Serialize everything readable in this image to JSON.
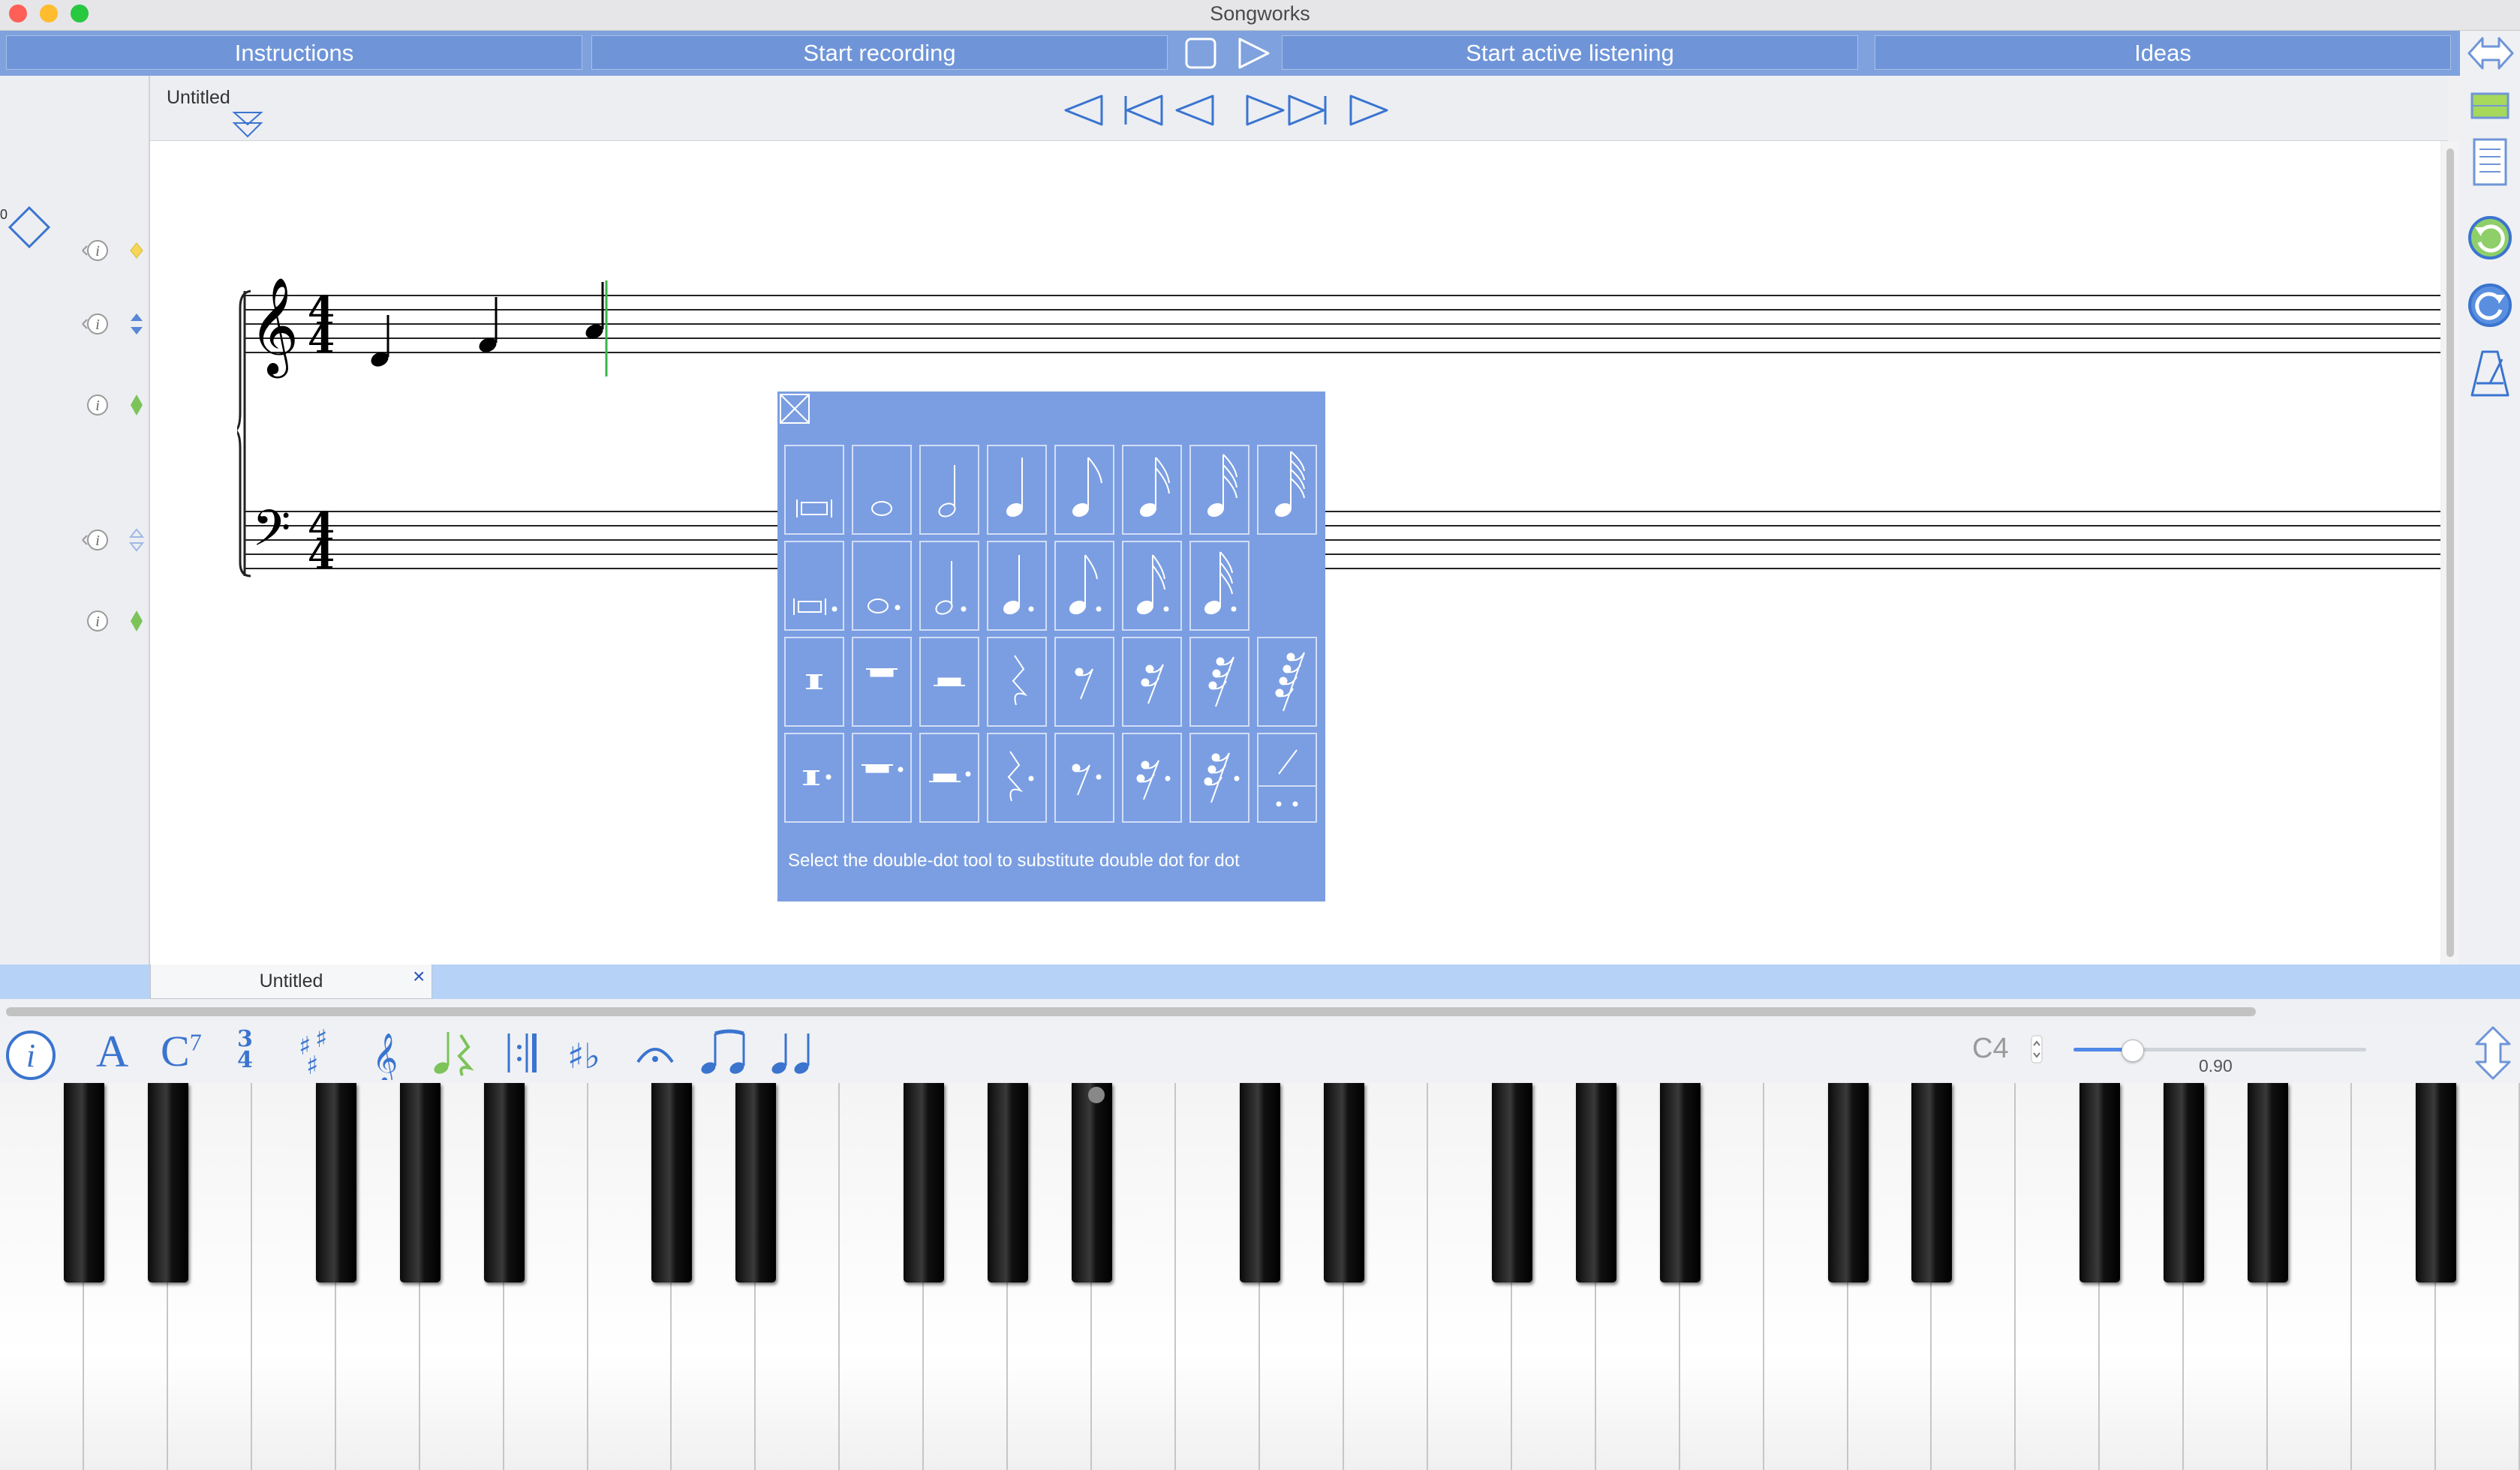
{
  "window": {
    "title": "Songworks"
  },
  "toolbar": {
    "instructions": "Instructions",
    "start_recording": "Start recording",
    "start_active_listening": "Start active listening",
    "ideas": "Ideas"
  },
  "document": {
    "title": "Untitled",
    "tab_label": "Untitled",
    "tab_close": "×",
    "marker_number": "0",
    "time_signature": {
      "top": "4",
      "bottom": "4"
    }
  },
  "palette": {
    "hint": "Select the double-dot tool to substitute double dot for dot",
    "rows": [
      [
        "breve",
        "whole-note",
        "half-note",
        "quarter-note",
        "eighth-note",
        "sixteenth-note",
        "thirty-second-note",
        "sixty-fourth-note"
      ],
      [
        "dotted-breve",
        "dotted-whole-note",
        "dotted-half-note",
        "dotted-quarter-note",
        "dotted-eighth-note",
        "dotted-sixteenth-note",
        "dotted-thirty-second-note"
      ],
      [
        "breve-rest",
        "whole-rest",
        "half-rest",
        "quarter-rest",
        "eighth-rest",
        "sixteenth-rest",
        "thirty-second-rest",
        "sixty-fourth-rest"
      ],
      [
        "dotted-breve-rest",
        "dotted-whole-rest",
        "dotted-half-rest",
        "dotted-quarter-rest",
        "dotted-eighth-rest",
        "dotted-sixteenth-rest",
        "dotted-thirty-second-rest",
        "double-dot-tool"
      ]
    ]
  },
  "bottom_toolbar": {
    "text_tool": "A",
    "chord_tool": "C",
    "chord_sup": "7",
    "time_sig_top": "3",
    "time_sig_bottom": "4",
    "pitch": "C4",
    "tempo_value": "0.90",
    "tempo_level": 0.2
  },
  "icons": [
    "info-icon",
    "text-icon",
    "chord-icon",
    "time-signature-icon",
    "key-signature-icon",
    "clef-icon",
    "note-rest-icon",
    "barline-icon",
    "accidental-icon",
    "fermata-icon",
    "beam-icon",
    "tie-icon"
  ],
  "colors": {
    "toolbar_blue": "#7fa1dd",
    "palette_blue": "#7b9ee2",
    "icon_blue": "#3a74cf",
    "cursor_green": "#39b54a"
  }
}
